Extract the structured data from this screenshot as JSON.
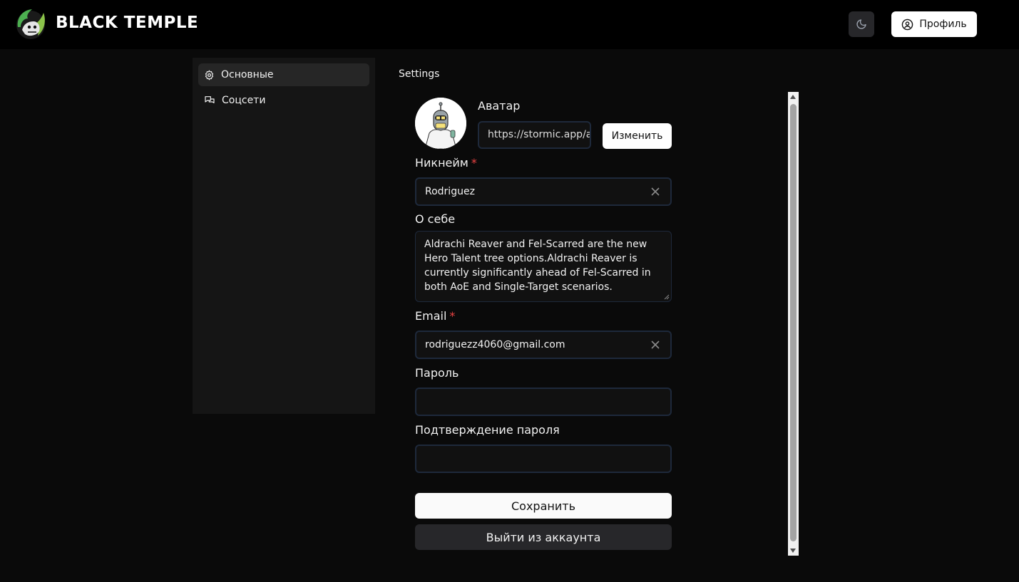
{
  "header": {
    "brand": "BLACK TEMPLE",
    "profile_label": "Профиль",
    "theme_icon": "moon-icon",
    "profile_icon": "user-circle-icon"
  },
  "sidebar": {
    "items": [
      {
        "label": "Основные",
        "icon": "gear-icon",
        "active": true
      },
      {
        "label": "Соцсети",
        "icon": "chat-bubbles-icon",
        "active": false
      }
    ]
  },
  "main": {
    "title": "Settings",
    "avatar": {
      "label": "Аватар",
      "url_value": "https://stormic.app/ap",
      "change_label": "Изменить"
    },
    "nickname": {
      "label": "Никнейм",
      "required_mark": "*",
      "value": "Rodriguez"
    },
    "about": {
      "label": "О себе",
      "value": "Aldrachi Reaver and Fel-Scarred are the new Hero Talent tree options.Aldrachi Reaver is currently significantly ahead of Fel-Scarred in both AoE and Single-Target scenarios."
    },
    "email": {
      "label": "Email",
      "required_mark": "*",
      "value": "rodriguezz4060@gmail.com"
    },
    "password": {
      "label": "Пароль",
      "value": ""
    },
    "password_confirm": {
      "label": "Подтверждение пароля",
      "value": ""
    },
    "save_label": "Сохранить",
    "logout_label": "Выйти из аккаунта"
  },
  "colors": {
    "background": "#0a0a0a",
    "header": "#000000",
    "sidebar": "#151515",
    "required": "#ef4444",
    "field_border": "#1e293b"
  }
}
